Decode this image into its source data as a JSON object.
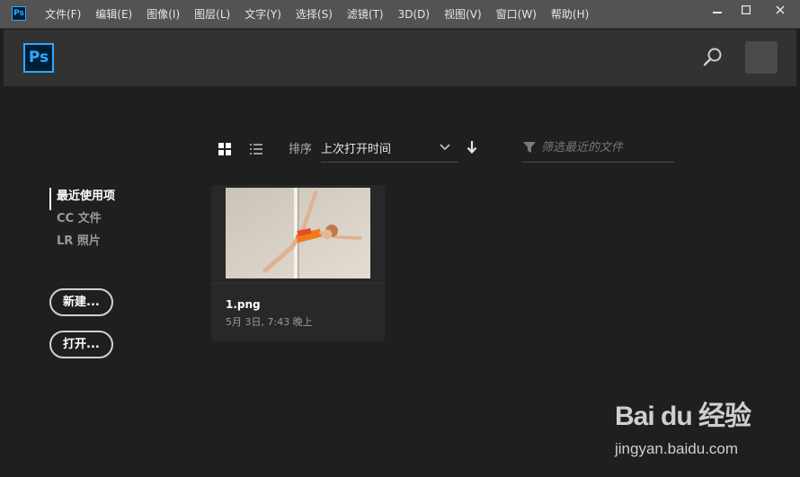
{
  "app": {
    "icon_label": "Ps",
    "logo_label": "Ps"
  },
  "menu": [
    "文件(F)",
    "编辑(E)",
    "图像(I)",
    "图层(L)",
    "文字(Y)",
    "选择(S)",
    "滤镜(T)",
    "3D(D)",
    "视图(V)",
    "窗口(W)",
    "帮助(H)"
  ],
  "window_controls": [
    "minimize-icon",
    "maximize-icon",
    "close-icon"
  ],
  "nav": {
    "items": [
      "最近使用项",
      "CC 文件",
      "LR 照片"
    ],
    "active_index": 0
  },
  "actions": {
    "new_label": "新建...",
    "open_label": "打开..."
  },
  "toolbar": {
    "sort_label": "排序",
    "sort_value": "上次打开时间",
    "filter_placeholder": "筛选最近的文件"
  },
  "recent_files": [
    {
      "name": "1.png",
      "date": "5月 3日, 7:43 晚上"
    }
  ],
  "watermark": {
    "brand": "Bai du 经验",
    "url": "jingyan.baidu.com"
  },
  "colors": {
    "accent": "#31a8ff",
    "background": "#1f1f1f",
    "header": "#323232",
    "titlebar": "#535353"
  }
}
